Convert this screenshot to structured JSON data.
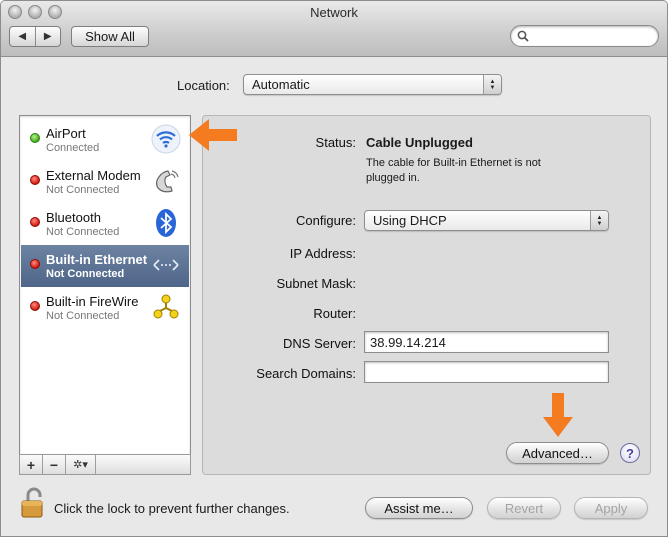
{
  "window": {
    "title": "Network"
  },
  "toolbar": {
    "back": "◀",
    "forward": "▶",
    "show_all": "Show All",
    "search": {
      "placeholder": "",
      "value": ""
    }
  },
  "location": {
    "label": "Location:",
    "value": "Automatic"
  },
  "services": [
    {
      "name": "AirPort",
      "status": "Connected",
      "state": "green",
      "icon": "wifi-icon",
      "selected": false
    },
    {
      "name": "External Modem",
      "status": "Not Connected",
      "state": "red",
      "icon": "phone-icon",
      "selected": false
    },
    {
      "name": "Bluetooth",
      "status": "Not Connected",
      "state": "red",
      "icon": "bluetooth-icon",
      "selected": false
    },
    {
      "name": "Built-in Ethernet",
      "status": "Not Connected",
      "state": "red",
      "icon": "ethernet-icon",
      "selected": true
    },
    {
      "name": "Built-in FireWire",
      "status": "Not Connected",
      "state": "red",
      "icon": "firewire-icon",
      "selected": false
    }
  ],
  "list_buttons": {
    "add": "+",
    "remove": "−",
    "gear": "✲▾"
  },
  "detail": {
    "status_label": "Status:",
    "status_value": "Cable Unplugged",
    "status_desc": "The cable for Built-in Ethernet is not plugged in.",
    "configure_label": "Configure:",
    "configure_value": "Using DHCP",
    "ip_label": "IP Address:",
    "subnet_label": "Subnet Mask:",
    "router_label": "Router:",
    "dns_label": "DNS Server:",
    "dns_value": "38.99.14.214",
    "search_domains_label": "Search Domains:",
    "search_domains_value": "",
    "advanced": "Advanced…",
    "help": "?"
  },
  "footer": {
    "lock_text": "Click the lock to prevent further changes.",
    "assist": "Assist me…",
    "revert": "Revert",
    "apply": "Apply"
  },
  "colors": {
    "annotation_arrow": "#f47b20",
    "selection": "#58709a",
    "status_green": "#3fae1a",
    "status_red": "#d11a0f"
  }
}
